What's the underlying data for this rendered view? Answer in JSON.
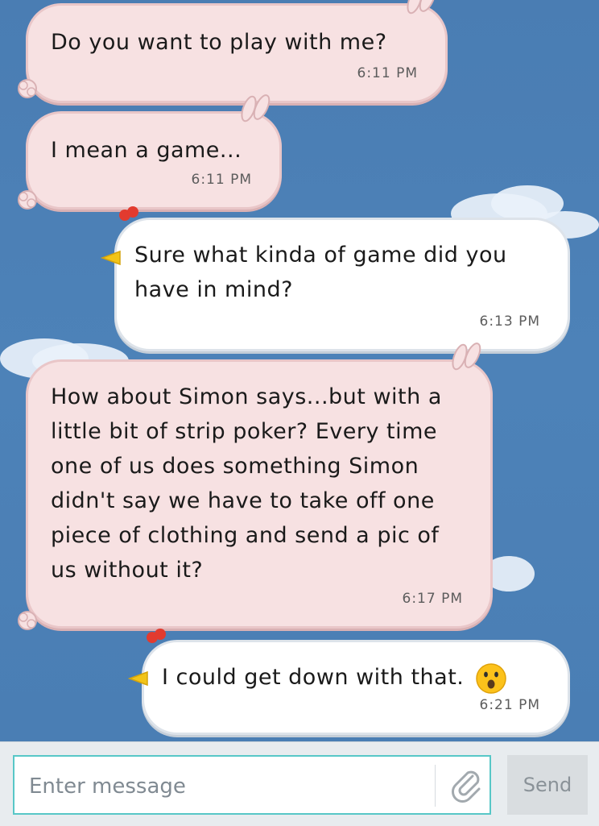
{
  "messages": [
    {
      "id": "m1",
      "direction": "incoming",
      "text": "Do you want to play with me?",
      "time": "6:11 PM"
    },
    {
      "id": "m2",
      "direction": "incoming",
      "text": "I mean a game...",
      "time": "6:11 PM"
    },
    {
      "id": "m3",
      "direction": "outgoing",
      "text": "Sure what kinda of game did you have in mind?",
      "time": "6:13 PM"
    },
    {
      "id": "m4",
      "direction": "incoming",
      "text": "How about Simon says...but with a little bit of strip poker? Every time one of us does something Simon didn't say we have to take off one piece of clothing and send a pic of us without it?",
      "time": "6:17 PM"
    },
    {
      "id": "m5",
      "direction": "outgoing",
      "text": "I could get down with that.",
      "time": "6:21 PM",
      "emoji": "hushed-face-emoji"
    }
  ],
  "composer": {
    "placeholder": "Enter message",
    "attach_icon": "paperclip-icon",
    "send_label": "Send"
  },
  "colors": {
    "background": "#4b7fb3",
    "incoming_bubble": "#f7e1e2",
    "outgoing_bubble": "#ffffff",
    "input_border": "#57c7c7"
  }
}
